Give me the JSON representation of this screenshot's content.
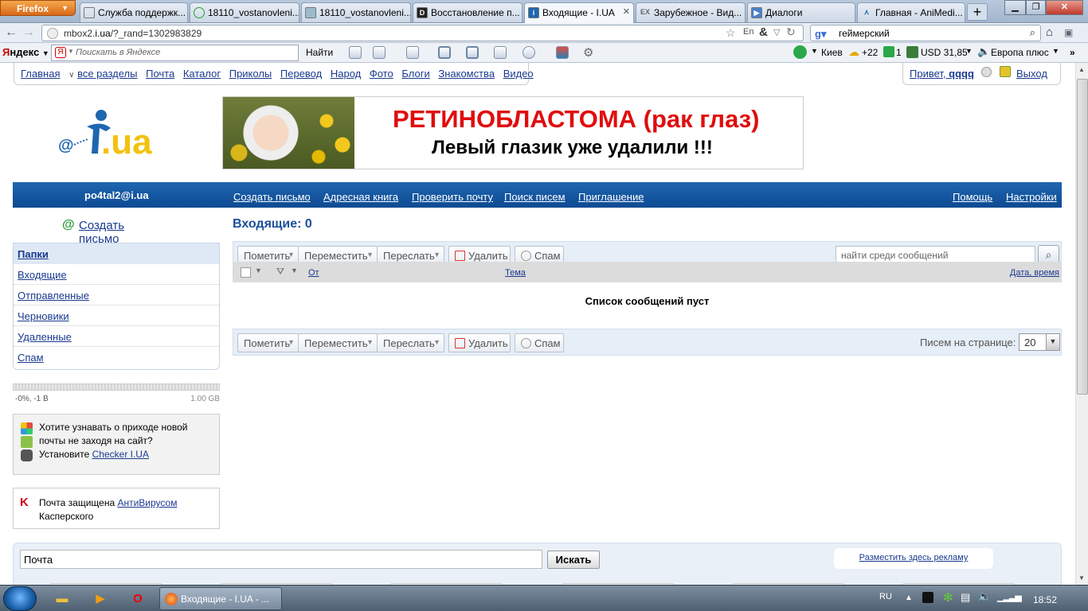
{
  "browser": {
    "firefox_button": "Firefox",
    "tabs": [
      {
        "label": "Служба поддержк...",
        "icon": "page-icon"
      },
      {
        "label": "18110_vostanovleni...",
        "icon": "loading-icon"
      },
      {
        "label": "18110_vostanovleni...",
        "icon": "image-icon"
      },
      {
        "label": "Восстановление п...",
        "icon": "d-icon"
      },
      {
        "label": "Входящие - I.UA",
        "icon": "iua-icon",
        "active": true
      },
      {
        "label": "Зарубежное - Вид...",
        "icon": "ex-icon"
      },
      {
        "label": "Диалоги",
        "icon": "dialog-icon"
      },
      {
        "label": "Главная - AniMedi...",
        "icon": "animedia-icon"
      }
    ],
    "new_tab": "+",
    "url_prefix": "mbox2.",
    "url_domain": "i.ua",
    "url_suffix": "/?_rand=1302983829",
    "search_text": "геймерский",
    "search_engine_icon": "google-icon"
  },
  "yandex_toolbar": {
    "logo_first": "Я",
    "logo_rest": "ндекс",
    "search_placeholder": "Поискать в Яндексе",
    "find_label": "Найти",
    "city": "Киев",
    "temperature": "+22",
    "mail_count": "1",
    "currency": "USD 31,85",
    "radio": "Европа плюс"
  },
  "site": {
    "menu": [
      "Главная",
      "все разделы",
      "Почта",
      "Каталог",
      "Приколы",
      "Перевод",
      "Народ",
      "Фото",
      "Блоги",
      "Знакомства",
      "Видео"
    ],
    "greeting": "Привет,",
    "username": "qqqq",
    "logout": "Выход",
    "logo_text": ".ua",
    "banner_title": "РЕТИНОБЛАСТОМА (рак глаз)",
    "banner_subtitle": "Левый глазик уже удалили !!!"
  },
  "mail_nav": {
    "email": "po4tal2@i.ua",
    "links": [
      "Создать письмо",
      "Адресная книга",
      "Проверить почту",
      "Поиск писем",
      "Приглашение"
    ],
    "help": "Помощь",
    "settings": "Настройки"
  },
  "sidebar": {
    "create": "Создать письмо",
    "folders_header": "Папки",
    "folders": [
      "Входящие",
      "Отправленные",
      "Черновики",
      "Удаленные",
      "Спам"
    ],
    "quota_used": "-0%, -1 B",
    "quota_total": "1.00 GB",
    "checker_line1": "Хотите узнавать о приходе новой",
    "checker_line2": "почты не заходя на сайт?",
    "checker_prefix": "Установите",
    "checker_link": "Checker I.UA",
    "kasp_prefix": "Почта защищена",
    "kasp_link": "АнтиВирусом",
    "kasp_suffix": "Касперского"
  },
  "inbox": {
    "title": "Входящие: 0",
    "toolbar": {
      "mark": "Пометить",
      "move": "Переместить",
      "forward": "Переслать",
      "delete": "Удалить",
      "spam": "Спам"
    },
    "search_placeholder": "найти среди сообщений",
    "columns": {
      "from": "От",
      "subject": "Тема",
      "date": "Дата, время"
    },
    "empty_message": "Список сообщений пуст",
    "per_page_label": "Писем на странице:",
    "per_page_value": "20"
  },
  "bottom": {
    "search_value": "Почта",
    "search_button": "Искать",
    "ad_link": "Разместить здесь рекламу"
  },
  "taskbar": {
    "task_label": "Входящие - I.UA - ...",
    "lang": "RU",
    "time": "18:52"
  },
  "colors": {
    "accent_blue": "#0d4a92",
    "banner_red": "#e00d0d",
    "link": "#1a3a8f"
  }
}
